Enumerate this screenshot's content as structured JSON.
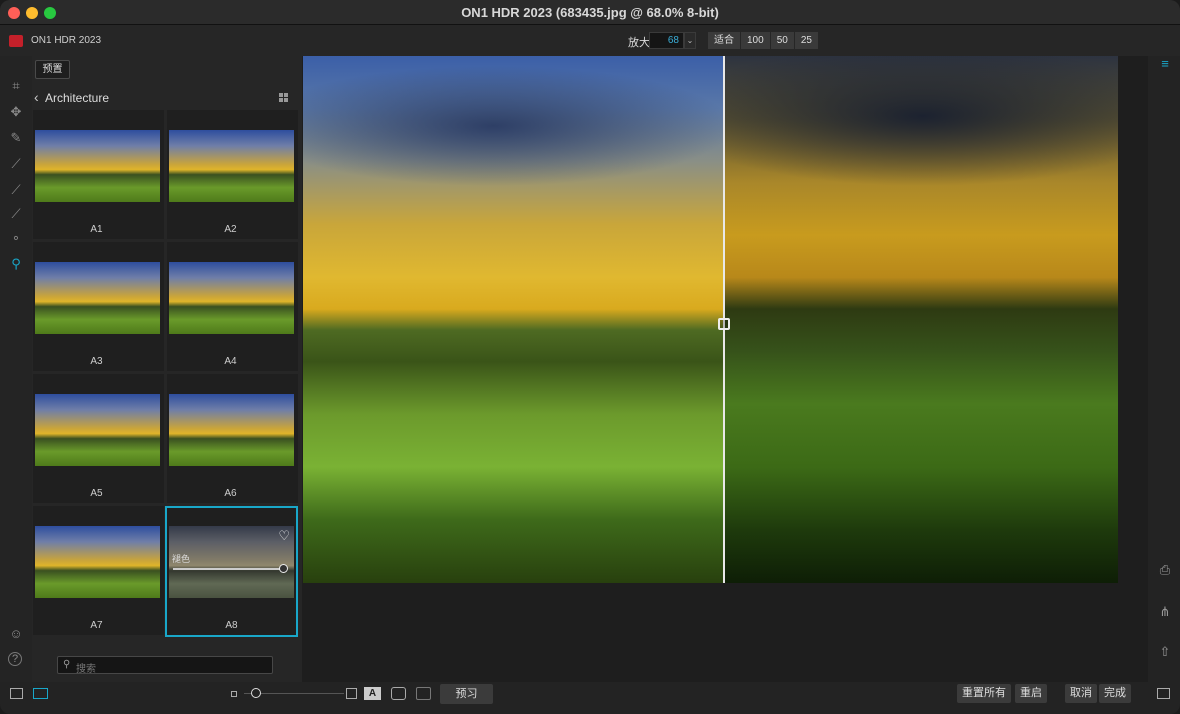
{
  "window": {
    "title": "ON1 HDR 2023 (683435.jpg @ 68.0% 8-bit)"
  },
  "appbar": {
    "app_name": "ON1 HDR 2023",
    "zoom_label": "放大",
    "zoom_value": "68",
    "zoom_buttons": [
      "适合",
      "100",
      "50",
      "25"
    ]
  },
  "tools": [
    "crop-icon",
    "move-icon",
    "brush-icon",
    "retouch-icon",
    "mask-brush-icon",
    "mask-eraser-icon",
    "refine-icon",
    "zoom-hand-icon",
    "person-icon",
    "help-icon"
  ],
  "left_panel": {
    "preset_tab": "预置",
    "category": "Architecture",
    "presets": [
      {
        "label": "A1",
        "selected": false
      },
      {
        "label": "A2",
        "selected": false
      },
      {
        "label": "A3",
        "selected": false
      },
      {
        "label": "A4",
        "selected": false
      },
      {
        "label": "A5",
        "selected": false
      },
      {
        "label": "A6",
        "selected": false
      },
      {
        "label": "A7",
        "selected": false
      },
      {
        "label": "A8",
        "selected": true
      }
    ],
    "selected_overlay": {
      "tint_label": "褪色",
      "tint_value": 1.0
    },
    "search_placeholder": "搜索"
  },
  "bottom": {
    "preview_label": "预习",
    "reset_all_label": "重置所有",
    "reset_label": "重启",
    "cancel_label": "取消",
    "done_label": "完成"
  },
  "colors": {
    "accent": "#19a7c9",
    "selection": "#19a7c9"
  }
}
